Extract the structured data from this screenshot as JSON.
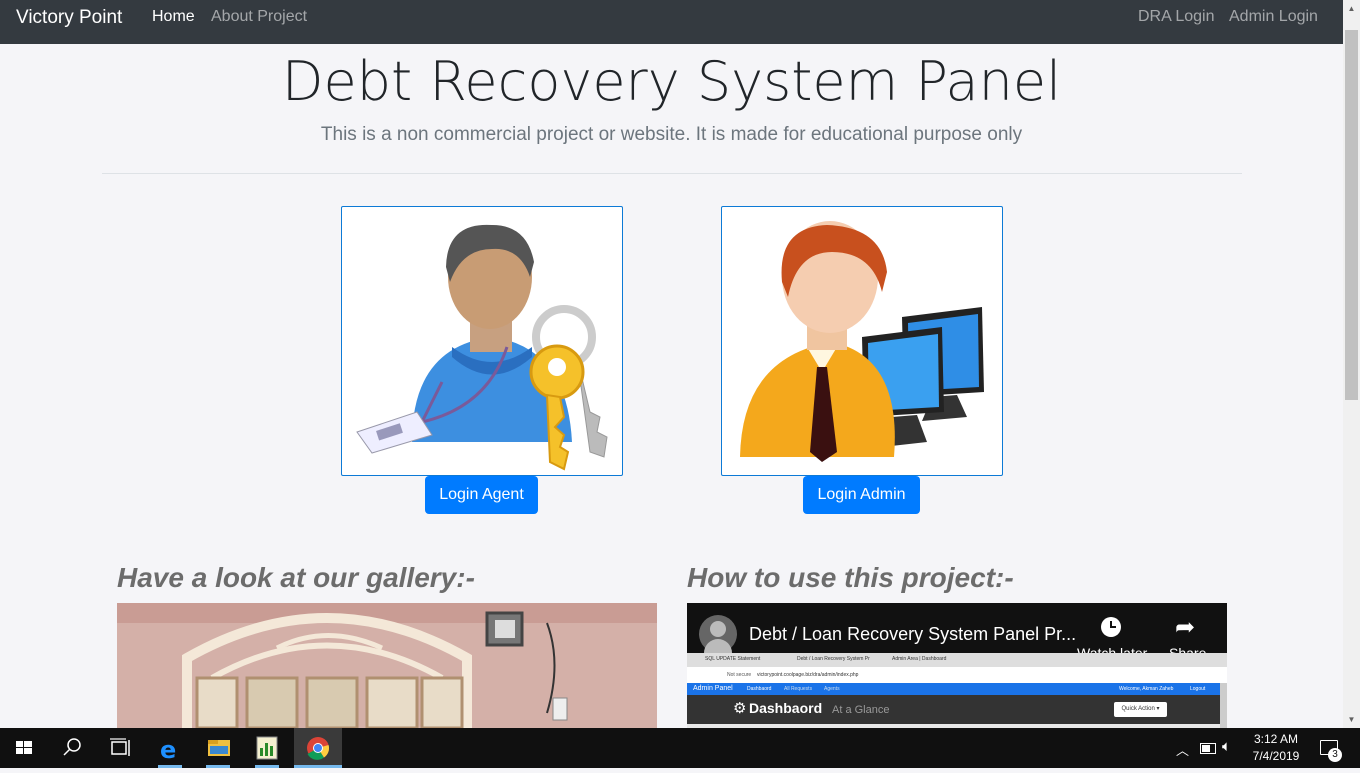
{
  "navbar": {
    "brand": "Victory Point",
    "links": [
      "Home",
      "About Project"
    ],
    "right_links": [
      "DRA Login",
      "Admin Login"
    ]
  },
  "hero": {
    "title": "Debt Recovery System Panel",
    "lead": "This is a non commercial project or website. It is made for educational purpose only"
  },
  "cards": {
    "agent_button": "Login Agent",
    "admin_button": "Login Admin"
  },
  "sections": {
    "gallery_title": "Have a look at our gallery:-",
    "howto_title": "How to use this project:-"
  },
  "video": {
    "title": "Debt / Loan Recovery System Panel Pr...",
    "watch_later": "Watch later",
    "share": "Share",
    "inner": {
      "tabs": [
        "SQL UPDATE Statement",
        "Debt / Loan Recovery System Pr",
        "Admin Area | Dashboard"
      ],
      "not_secure": "Not secure",
      "url": "victorypoint.coolpage.biz/dra/admin/index.php",
      "admin_panel": "Admin Panel",
      "nav": [
        "Dashbaord",
        "All Requests",
        "Agents"
      ],
      "welcome": "Welcome, Akman Zaheb",
      "logout": "Logout",
      "dashboard_title": "Dashbaord",
      "dashboard_sub": "At a Glance",
      "quick_action": "Quick Action ▾"
    }
  },
  "taskbar": {
    "time": "3:12 AM",
    "date": "7/4/2019",
    "notifications": "3"
  },
  "colors": {
    "navbar": "#343a40",
    "primary": "#007bff",
    "card_border": "#0d7ad6"
  }
}
